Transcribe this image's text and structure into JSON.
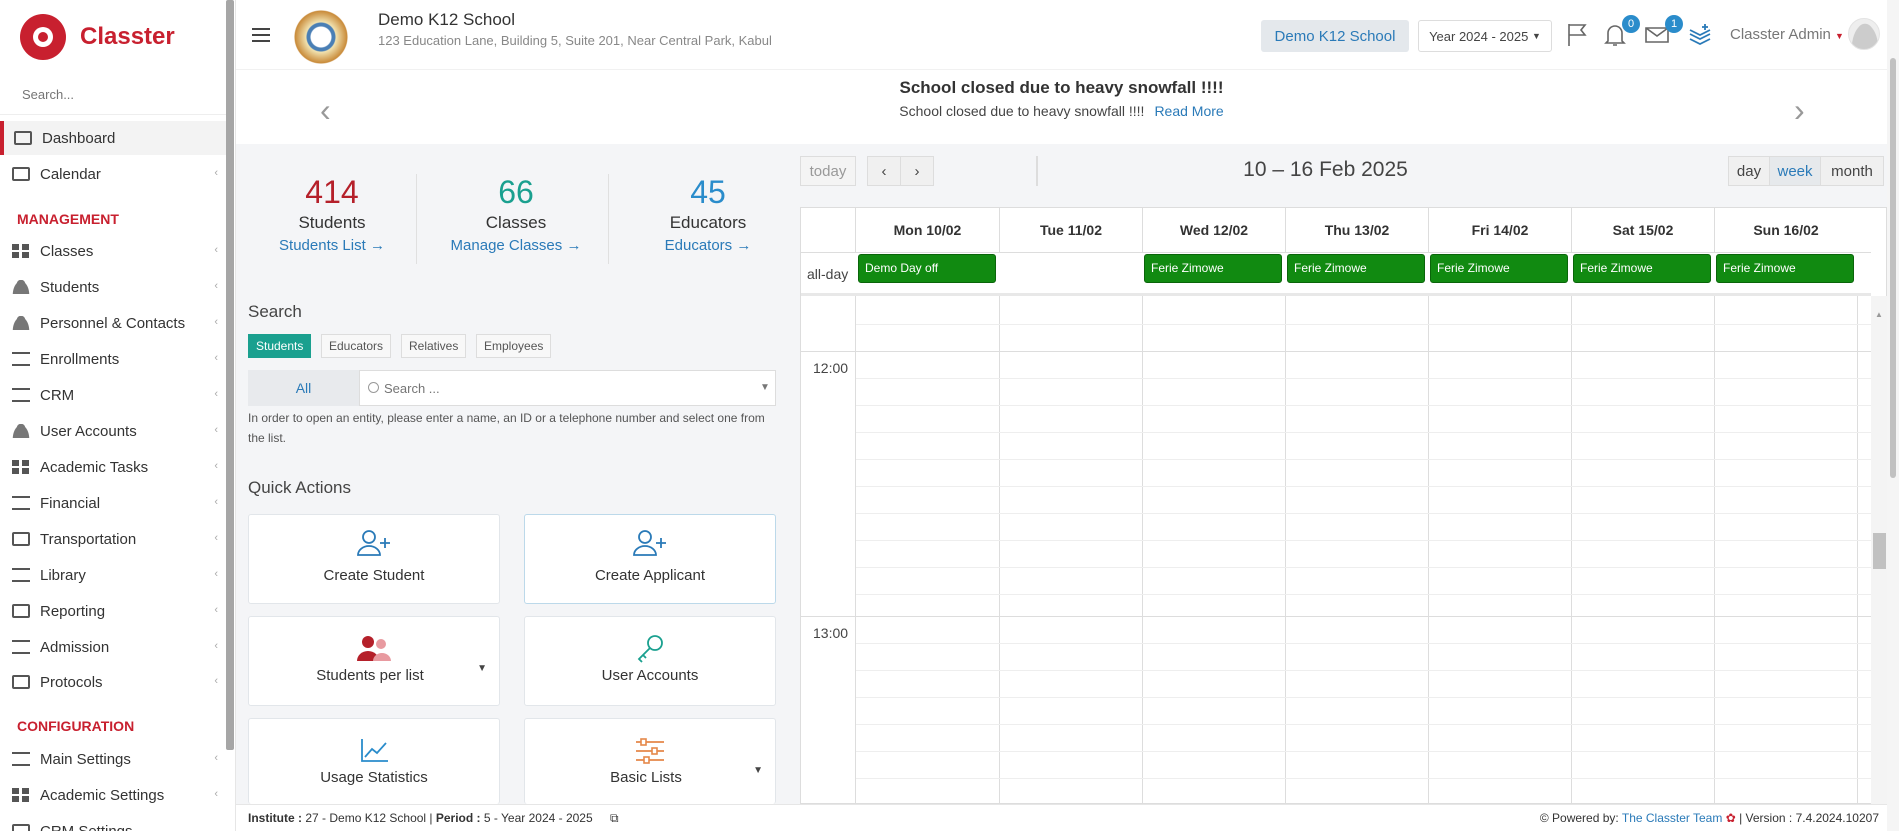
{
  "sidebar": {
    "brand": "Classter",
    "search_placeholder": "Search...",
    "items": [
      {
        "label": "Dashboard"
      },
      {
        "label": "Calendar"
      },
      {
        "label": "Classes"
      },
      {
        "label": "Students"
      },
      {
        "label": "Personnel & Contacts"
      },
      {
        "label": "Enrollments"
      },
      {
        "label": "CRM"
      },
      {
        "label": "User Accounts"
      },
      {
        "label": "Academic Tasks"
      },
      {
        "label": "Financial"
      },
      {
        "label": "Transportation"
      },
      {
        "label": "Library"
      },
      {
        "label": "Reporting"
      },
      {
        "label": "Admission"
      },
      {
        "label": "Protocols"
      },
      {
        "label": "Main Settings"
      },
      {
        "label": "Academic Settings"
      },
      {
        "label": "CRM Settings"
      }
    ],
    "section_management": "MANAGEMENT",
    "section_configuration": "CONFIGURATION"
  },
  "header": {
    "school_name": "Demo K12 School",
    "school_address": "123 Education Lane, Building 5, Suite 201, Near Central Park, Kabul",
    "school_button": "Demo K12 School",
    "year_select": "Year 2024 - 2025",
    "notifications_count": "0",
    "messages_count": "1",
    "user_name": "Classter Admin"
  },
  "announcement": {
    "title": "School closed due to heavy snowfall !!!!",
    "text": "School closed due to heavy snowfall !!!!",
    "read_more": "Read More"
  },
  "stats": [
    {
      "value": "414",
      "label": "Students",
      "link": "Students List",
      "color": "#b5202a"
    },
    {
      "value": "66",
      "label": "Classes",
      "link": "Manage Classes",
      "color": "#1aa08f"
    },
    {
      "value": "45",
      "label": "Educators",
      "link": "Educators",
      "color": "#2a8ccb"
    }
  ],
  "search": {
    "heading": "Search",
    "tabs": [
      "Students",
      "Educators",
      "Relatives",
      "Employees"
    ],
    "scope": "All",
    "placeholder": "Search ...",
    "help": "In order to open an entity, please enter a name, an ID or a telephone number and select one from the list."
  },
  "quick_actions": {
    "heading": "Quick Actions",
    "items": [
      {
        "label": "Create Student"
      },
      {
        "label": "Create Applicant"
      },
      {
        "label": "Students per list"
      },
      {
        "label": "User Accounts"
      },
      {
        "label": "Usage Statistics"
      },
      {
        "label": "Basic Lists"
      }
    ]
  },
  "calendar": {
    "today": "today",
    "prev": "‹",
    "next": "›",
    "title": "10 – 16 Feb 2025",
    "views": [
      "day",
      "week",
      "month"
    ],
    "active_view": "week",
    "days": [
      "Mon 10/02",
      "Tue 11/02",
      "Wed 12/02",
      "Thu 13/02",
      "Fri 14/02",
      "Sat 15/02",
      "Sun 16/02"
    ],
    "allday_label": "all-day",
    "events": [
      {
        "day": 0,
        "title": "Demo Day off"
      },
      {
        "day": 2,
        "title": "Ferie Zimowe"
      },
      {
        "day": 3,
        "title": "Ferie Zimowe"
      },
      {
        "day": 4,
        "title": "Ferie Zimowe"
      },
      {
        "day": 5,
        "title": "Ferie Zimowe"
      },
      {
        "day": 6,
        "title": "Ferie Zimowe"
      }
    ],
    "times": [
      "12:00",
      "13:00"
    ],
    "event_color": "#118a11"
  },
  "footer": {
    "institute_label": "Institute :",
    "institute_value": "27 - Demo K12 School",
    "period_label": "Period :",
    "period_value": "5 - Year 2024 - 2025",
    "powered_by": "Powered by:",
    "team": "The Classter Team",
    "version": "| Version : 7.4.2024.10207"
  }
}
